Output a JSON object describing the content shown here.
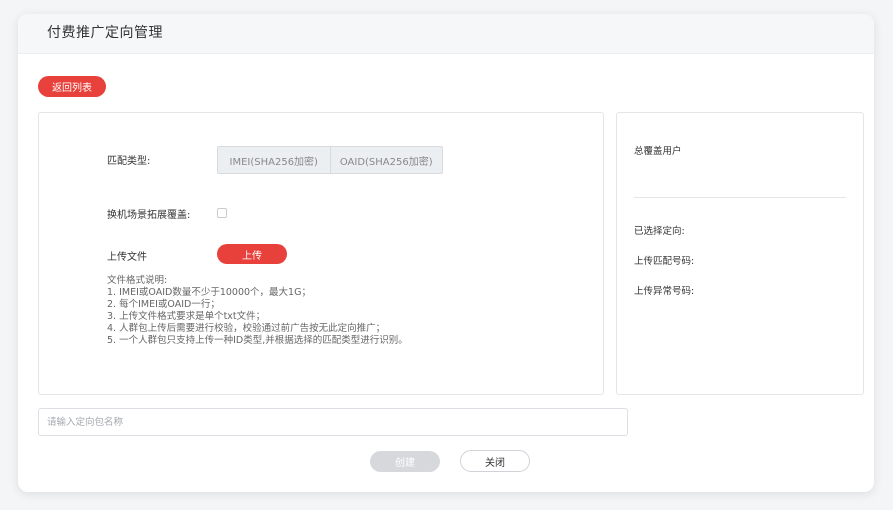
{
  "header": {
    "title": "付费推广定向管理"
  },
  "actions": {
    "back_label": "返回列表"
  },
  "form": {
    "match_type_label": "匹配类型:",
    "match_options": [
      "IMEI(SHA256加密)",
      "OAID(SHA256加密)"
    ],
    "extend_label": "换机场景拓展覆盖:",
    "extend_checked": false,
    "upload_label": "上传文件",
    "upload_button": "上传",
    "notes": [
      "文件格式说明:",
      "1. IMEI或OAID数量不少于10000个，最大1G；",
      "2. 每个IMEI或OAID一行；",
      "3. 上传文件格式要求是单个txt文件；",
      "4. 人群包上传后需要进行校验，校验通过前广告按无此定向推广；",
      "5. 一个人群包只支持上传一种ID类型,并根据选择的匹配类型进行识别。"
    ]
  },
  "summary": {
    "total_users_label": "总覆盖用户",
    "selected_label": "已选择定向:",
    "matched_label": "上传匹配号码:",
    "abnormal_label": "上传异常号码:"
  },
  "name_input": {
    "placeholder": "请输入定向包名称",
    "value": ""
  },
  "footer": {
    "create_label": "创建",
    "close_label": "关闭"
  },
  "colors": {
    "accent": "#e8413b",
    "disabled": "#d6d8db"
  }
}
